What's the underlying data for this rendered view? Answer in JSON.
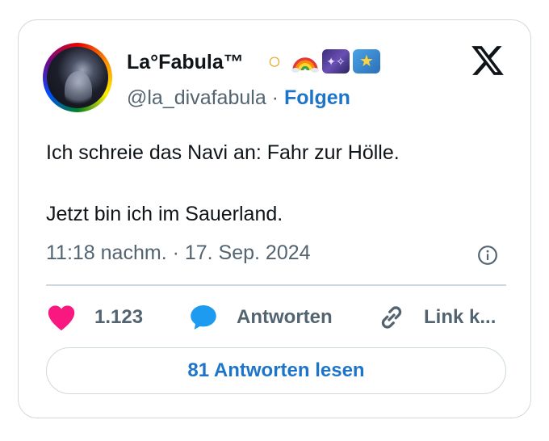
{
  "author": {
    "display_name": "La°Fabula™",
    "emojis": [
      "ring-emoji",
      "rainbow-emoji",
      "milky-way-emoji",
      "shooting-star-emoji"
    ],
    "handle": "@la_divafabula",
    "separator": "·",
    "follow_label": "Folgen"
  },
  "post": {
    "lines": [
      "Ich schreie das Navi an: Fahr zur Hölle.",
      "Jetzt bin ich im Sauerland."
    ],
    "timestamp": "11:18 nachm. · 17. Sep. 2024"
  },
  "actions": {
    "like_count": "1.123",
    "reply_label": "Antworten",
    "link_label": "Link k..."
  },
  "read_replies_label": "81 Antworten lesen",
  "colors": {
    "accent": "#1d74c9",
    "like": "#f91880",
    "reply": "#1d9bf0",
    "muted": "#536471"
  }
}
